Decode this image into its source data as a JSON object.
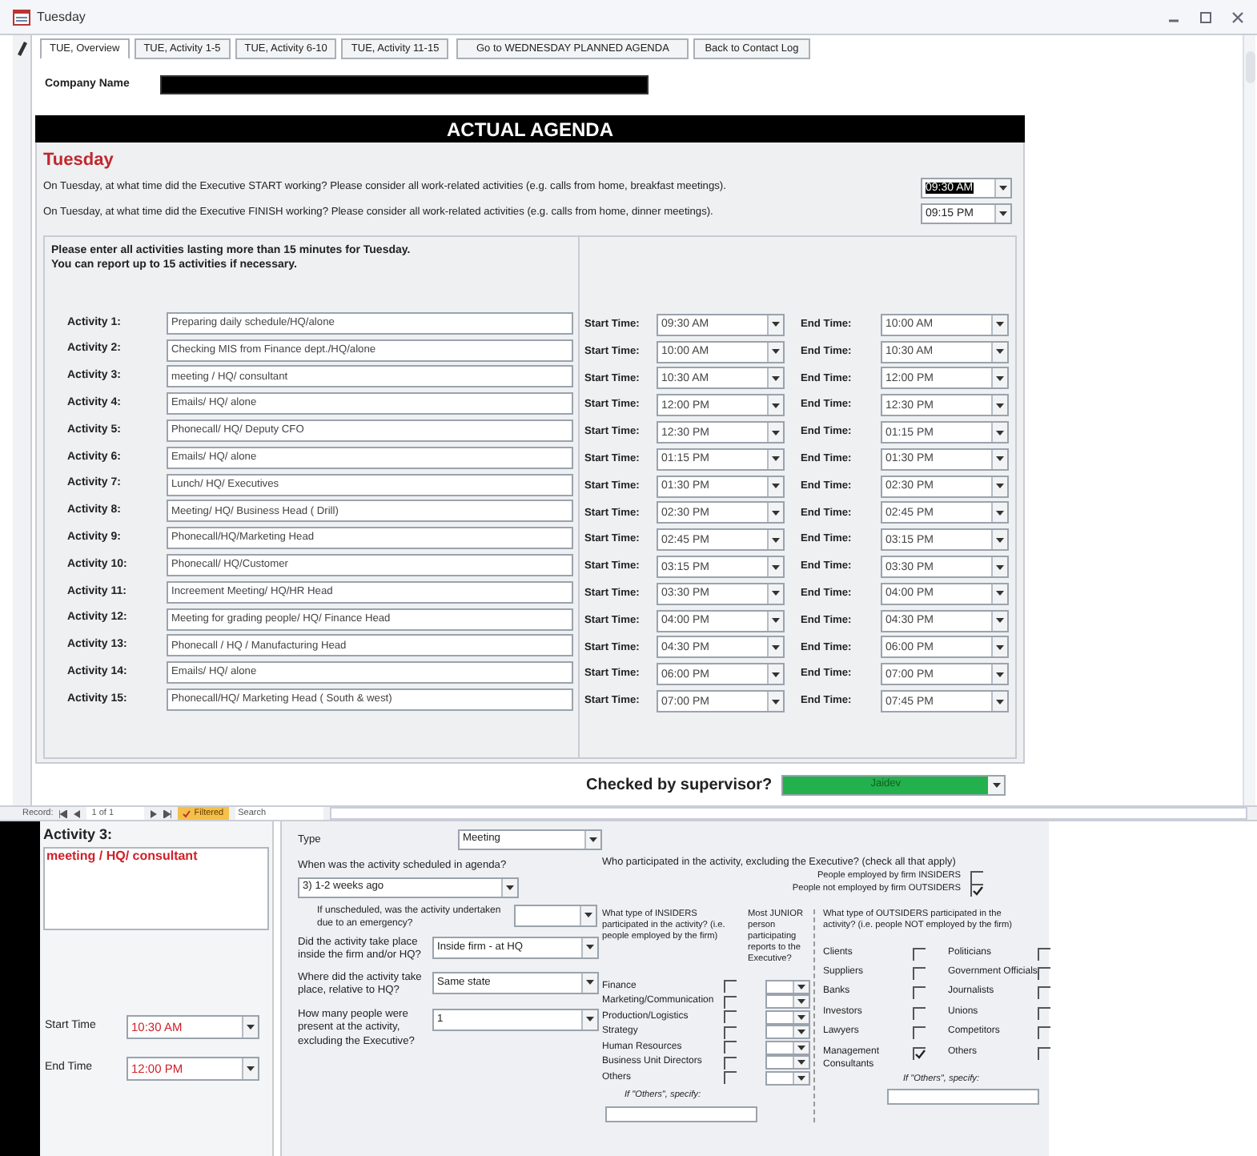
{
  "window": {
    "title": "Tuesday"
  },
  "tabs": [
    {
      "label": "TUE, Overview",
      "selected": true
    },
    {
      "label": "TUE, Activity 1-5",
      "selected": false
    },
    {
      "label": "TUE, Activity 6-10",
      "selected": false
    },
    {
      "label": "TUE, Activity 11-15",
      "selected": false
    }
  ],
  "nav_buttons": [
    "Go to WEDNESDAY PLANNED AGENDA",
    "Back to Contact Log"
  ],
  "company": {
    "label": "Company Name"
  },
  "header": "ACTUAL AGENDA",
  "day": "Tuesday",
  "work_times": [
    {
      "question": "On Tuesday, at what time did the Executive START working? Please consider all work-related activities (e.g. calls from home, breakfast meetings).",
      "value": "09:30 AM",
      "selected": true
    },
    {
      "question": "On Tuesday, at what time did the Executive FINISH working? Please consider all work-related activities (e.g. calls from home, dinner meetings).",
      "value": "09:15 PM",
      "selected": false
    }
  ],
  "instructions": [
    "Please enter all activities lasting more than 15 minutes for Tuesday.",
    "You can report up to 15 activities if necessary."
  ],
  "activities": [
    {
      "label": "Activity 1:",
      "description": "Preparing daily schedule/HQ/alone",
      "start_label": "Start Time:",
      "start": "09:30 AM",
      "end_label": "End Time:",
      "end": "10:00 AM"
    },
    {
      "label": "Activity 2:",
      "description": "Checking MIS from Finance dept./HQ/alone",
      "start_label": "Start Time:",
      "start": "10:00 AM",
      "end_label": "End Time:",
      "end": "10:30 AM"
    },
    {
      "label": "Activity 3:",
      "description": "meeting / HQ/ consultant",
      "start_label": "Start Time:",
      "start": "10:30 AM",
      "end_label": "End Time:",
      "end": "12:00 PM"
    },
    {
      "label": "Activity 4:",
      "description": "Emails/ HQ/ alone",
      "start_label": "Start Time:",
      "start": "12:00 PM",
      "end_label": "End Time:",
      "end": "12:30 PM"
    },
    {
      "label": "Activity 5:",
      "description": "Phonecall/ HQ/ Deputy CFO",
      "start_label": "Start Time:",
      "start": "12:30 PM",
      "end_label": "End Time:",
      "end": "01:15 PM"
    },
    {
      "label": "Activity 6:",
      "description": "Emails/ HQ/ alone",
      "start_label": "Start Time:",
      "start": "01:15 PM",
      "end_label": "End Time:",
      "end": "01:30 PM"
    },
    {
      "label": "Activity 7:",
      "description": "Lunch/ HQ/ Executives",
      "start_label": "Start Time:",
      "start": "01:30 PM",
      "end_label": "End Time:",
      "end": "02:30 PM"
    },
    {
      "label": "Activity 8:",
      "description": "Meeting/ HQ/ Business Head ( Drill)",
      "start_label": "Start Time:",
      "start": "02:30 PM",
      "end_label": "End Time:",
      "end": "02:45 PM"
    },
    {
      "label": "Activity 9:",
      "description": "Phonecall/HQ/Marketing Head",
      "start_label": "Start Time:",
      "start": "02:45 PM",
      "end_label": "End Time:",
      "end": "03:15 PM"
    },
    {
      "label": "Activity 10:",
      "description": "Phonecall/ HQ/Customer",
      "start_label": "Start Time:",
      "start": "03:15 PM",
      "end_label": "End Time:",
      "end": "03:30 PM"
    },
    {
      "label": "Activity 11:",
      "description": "Increement Meeting/ HQ/HR Head",
      "start_label": "Start Time:",
      "start": "03:30 PM",
      "end_label": "End Time:",
      "end": "04:00 PM"
    },
    {
      "label": "Activity 12:",
      "description": "Meeting for grading people/ HQ/ Finance Head",
      "start_label": "Start Time:",
      "start": "04:00 PM",
      "end_label": "End Time:",
      "end": "04:30 PM"
    },
    {
      "label": "Activity 13:",
      "description": "Phonecall / HQ / Manufacturing Head",
      "start_label": "Start Time:",
      "start": "04:30 PM",
      "end_label": "End Time:",
      "end": "06:00 PM"
    },
    {
      "label": "Activity 14:",
      "description": "Emails/ HQ/ alone",
      "start_label": "Start Time:",
      "start": "06:00 PM",
      "end_label": "End Time:",
      "end": "07:00 PM"
    },
    {
      "label": "Activity 15:",
      "description": "Phonecall/HQ/ Marketing Head ( South & west)",
      "start_label": "Start Time:",
      "start": "07:00 PM",
      "end_label": "End Time:",
      "end": "07:45 PM"
    }
  ],
  "supervisor": {
    "label": "Checked by supervisor?",
    "value": "Jaidev"
  },
  "record_nav": {
    "label": "Record:",
    "position": "1 of 1",
    "filter": "Filtered",
    "search_placeholder": "Search"
  },
  "detail": {
    "title": "Activity 3:",
    "description": "meeting / HQ/ consultant",
    "start_label": "Start Time",
    "start": "10:30 AM",
    "end_label": "End Time",
    "end": "12:00 PM"
  },
  "type": {
    "label": "Type",
    "value": "Meeting"
  },
  "scheduled": {
    "label": "When was the activity scheduled in agenda?",
    "value": "3) 1-2 weeks ago"
  },
  "emergency": {
    "label": "If unscheduled, was the activity undertaken due to an emergency?"
  },
  "place": {
    "label": "Did the activity take place inside the firm and/or HQ?",
    "value": "Inside firm - at HQ"
  },
  "location": {
    "label": "Where did the activity take place, relative to HQ?",
    "value": "Same state"
  },
  "people_count": {
    "label": "How many people were present at the activity, excluding the Executive?",
    "value": "1"
  },
  "participants": {
    "question": "Who participated in the activity, excluding the Executive? (check all that apply)",
    "options": [
      {
        "label": "People employed by firm INSIDERS",
        "checked": false
      },
      {
        "label": "People not employed by firm OUTSIDERS",
        "checked": true
      }
    ]
  },
  "insiders": {
    "question": "What type of INSIDERS participated in the activity? (i.e. people employed by the firm)",
    "junior_question": "Most JUNIOR person participating reports to the Executive?",
    "others_label": "If \"Others\", specify:",
    "items": [
      {
        "label": "Finance",
        "checked": false
      },
      {
        "label": "Marketing/Communication",
        "checked": false
      },
      {
        "label": "Production/Logistics",
        "checked": false
      },
      {
        "label": "Strategy",
        "checked": false
      },
      {
        "label": "Human Resources",
        "checked": false
      },
      {
        "label": "Business Unit Directors",
        "checked": false
      },
      {
        "label": "Others",
        "checked": false
      }
    ]
  },
  "outsiders": {
    "question": "What type of OUTSIDERS participated in the activity? (i.e. people NOT employed by the firm)",
    "others_label": "If \"Others\", specify:",
    "items": [
      {
        "label": "Clients",
        "checked": false
      },
      {
        "label": "Suppliers",
        "checked": false
      },
      {
        "label": "Banks",
        "checked": false
      },
      {
        "label": "Investors",
        "checked": false
      },
      {
        "label": "Lawyers",
        "checked": false
      },
      {
        "label": "Management Consultants",
        "checked": true
      },
      {
        "label": "Politicians",
        "checked": false
      },
      {
        "label": "Government Officials",
        "checked": false
      },
      {
        "label": "Journalists",
        "checked": false
      },
      {
        "label": "Unions",
        "checked": false
      },
      {
        "label": "Competitors",
        "checked": false
      },
      {
        "label": "Others",
        "checked": false
      }
    ]
  }
}
